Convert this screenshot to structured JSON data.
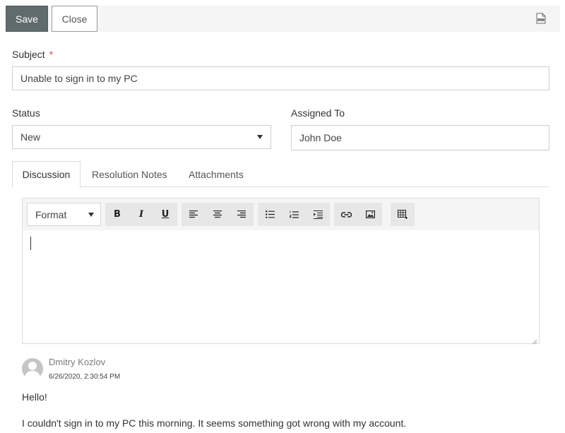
{
  "toolbar": {
    "save_label": "Save",
    "close_label": "Close",
    "pdf_icon": "pdf-icon"
  },
  "form": {
    "subject_label": "Subject",
    "required_marker": "*",
    "subject_value": "Unable to sign in to my PC",
    "status_label": "Status",
    "status_value": "New",
    "assigned_label": "Assigned To",
    "assigned_value": "John Doe"
  },
  "tabs": [
    {
      "label": "Discussion",
      "active": true
    },
    {
      "label": "Resolution Notes",
      "active": false
    },
    {
      "label": "Attachments",
      "active": false
    }
  ],
  "editor": {
    "format_label": "Format",
    "buttons": [
      "bold-icon",
      "italic-icon",
      "underline-icon",
      "align-left-icon",
      "align-center-icon",
      "align-right-icon",
      "bullet-list-icon",
      "numbered-list-icon",
      "indent-icon",
      "link-icon",
      "image-icon",
      "table-icon"
    ]
  },
  "comment": {
    "author": "Dmitry Kozlov",
    "timestamp": "6/26/2020, 2:30:54 PM",
    "line1": "Hello!",
    "line2": "I couldn't sign in to my PC this morning. It seems something got wrong with my account."
  },
  "colors": {
    "save_bg": "#5f6b6d",
    "required": "#e04848",
    "toolbar_bg": "#f5f5f5"
  }
}
